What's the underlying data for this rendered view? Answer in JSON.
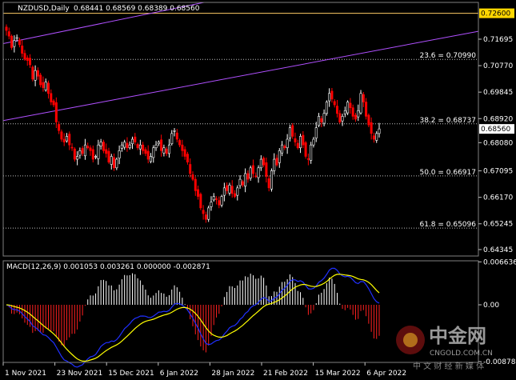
{
  "header": {
    "symbol": "NZDUSD,Daily",
    "ohlc": "0.68441 0.68569 0.68389 0.68560"
  },
  "macd": {
    "label": "MACD(12,26,9) 0.001053 0.003261 0.000000 -0.002871"
  },
  "watermark": {
    "brand_cn": "中金网",
    "domain": "CNGOLD.COM.CN",
    "slogan": "中 文 财 经 新 媒 体"
  },
  "colors": {
    "background": "#000000",
    "bull_candle": "#ffffff",
    "bear_candle": "#ff0000",
    "fib_line": "#c0c0c0",
    "trend_line": "#b050ff",
    "level_line": "#ffcc66",
    "macd_main": "#2030ff",
    "macd_signal": "#ffff00",
    "hist_pos": "#ffffff",
    "hist_neg": "#ff2020"
  },
  "chart_data": {
    "type": "candlestick",
    "price_axis": {
      "ticks": [
        "0.71695",
        "0.70770",
        "0.69845",
        "0.68920",
        "0.68080",
        "0.67095",
        "0.66170",
        "0.65245",
        "0.64345"
      ],
      "ylim": [
        0.6412,
        0.7298
      ]
    },
    "highlight_level": "0.72600",
    "current_price": "0.68560",
    "fibonacci": [
      {
        "label": "23.6 = 0.70990",
        "value": 0.7099
      },
      {
        "label": "38.2 = 0.68737",
        "value": 0.68737
      },
      {
        "label": "50.0 = 0.66917",
        "value": 0.66917
      },
      {
        "label": "61.8 = 0.65096",
        "value": 0.65096
      }
    ],
    "time_axis": [
      "1 Nov 2021",
      "23 Nov 2021",
      "15 Dec 2021",
      "6 Jan 2022",
      "28 Jan 2022",
      "21 Feb 2022",
      "15 Mar 2022",
      "6 Apr 2022"
    ],
    "closes": [
      0.72,
      0.718,
      0.714,
      0.7165,
      0.7175,
      0.715,
      0.712,
      0.71,
      0.7095,
      0.708,
      0.703,
      0.706,
      0.704,
      0.701,
      0.7,
      0.702,
      0.698,
      0.695,
      0.694,
      0.688,
      0.685,
      0.682,
      0.681,
      0.683,
      0.68,
      0.679,
      0.675,
      0.676,
      0.678,
      0.677,
      0.68,
      0.679,
      0.678,
      0.675,
      0.676,
      0.68,
      0.681,
      0.678,
      0.677,
      0.674,
      0.676,
      0.672,
      0.675,
      0.678,
      0.68,
      0.681,
      0.679,
      0.68,
      0.682,
      0.681,
      0.679,
      0.68,
      0.678,
      0.677,
      0.675,
      0.676,
      0.679,
      0.68,
      0.681,
      0.678,
      0.679,
      0.677,
      0.68,
      0.684,
      0.685,
      0.682,
      0.68,
      0.678,
      0.676,
      0.674,
      0.67,
      0.668,
      0.664,
      0.662,
      0.658,
      0.656,
      0.654,
      0.658,
      0.66,
      0.662,
      0.661,
      0.659,
      0.662,
      0.665,
      0.664,
      0.666,
      0.663,
      0.662,
      0.665,
      0.668,
      0.666,
      0.67,
      0.668,
      0.672,
      0.67,
      0.669,
      0.672,
      0.675,
      0.673,
      0.669,
      0.665,
      0.671,
      0.675,
      0.673,
      0.678,
      0.68,
      0.679,
      0.682,
      0.686,
      0.683,
      0.681,
      0.679,
      0.683,
      0.68,
      0.676,
      0.675,
      0.68,
      0.682,
      0.686,
      0.69,
      0.688,
      0.691,
      0.695,
      0.698,
      0.696,
      0.694,
      0.691,
      0.688,
      0.69,
      0.692,
      0.695,
      0.693,
      0.69,
      0.689,
      0.692,
      0.698,
      0.695,
      0.69,
      0.687,
      0.684,
      0.682,
      0.684,
      0.6856
    ],
    "macd_axis": {
      "ticks": [
        "0.006636",
        "0.00",
        "-0.008784"
      ],
      "ylim": [
        -0.0089,
        0.0068
      ]
    }
  }
}
